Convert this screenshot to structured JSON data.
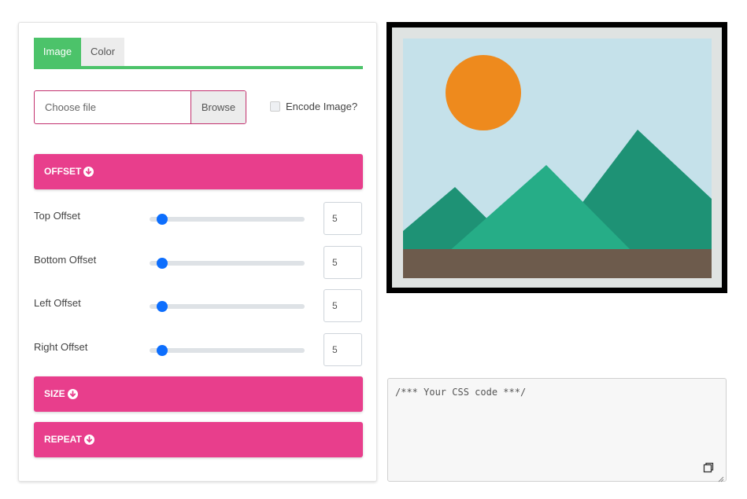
{
  "tabs": [
    {
      "label": "Image",
      "active": true
    },
    {
      "label": "Color",
      "active": false
    }
  ],
  "file_input": {
    "placeholder": "Choose file",
    "browse_label": "Browse"
  },
  "encode": {
    "label": "Encode Image?",
    "checked": false
  },
  "sections": {
    "offset": "OFFSET",
    "size": "SIZE",
    "repeat": "REPEAT"
  },
  "offsets": [
    {
      "label": "Top Offset",
      "value": "5",
      "fraction": 0.08
    },
    {
      "label": "Bottom Offset",
      "value": "5",
      "fraction": 0.08
    },
    {
      "label": "Left Offset",
      "value": "5",
      "fraction": 0.08
    },
    {
      "label": "Right Offset",
      "value": "5",
      "fraction": 0.08
    }
  ],
  "code": {
    "placeholder": "/*** Your CSS code ***/"
  },
  "colors": {
    "accent": "#e83e8c",
    "tab_active": "#4cc36a",
    "slider": "#0d6efd"
  },
  "icons": {
    "section_icon": "arrow-circle-down-icon",
    "copy_icon": "copy-icon",
    "preview_image": "landscape-placeholder-icon"
  }
}
